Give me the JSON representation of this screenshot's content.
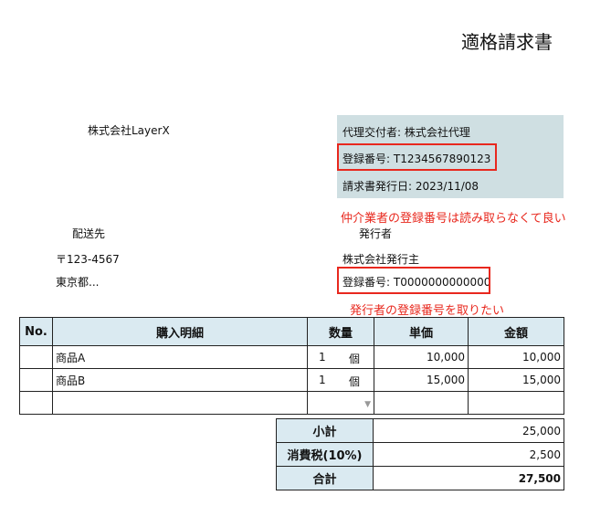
{
  "title": "適格請求書",
  "bill_to": "株式会社LayerX",
  "agent": {
    "issuer": "代理交付者: 株式会社代理",
    "registration": "登録番号: T1234567890123",
    "issue_date": "請求書発行日: 2023/11/08"
  },
  "note_agent": "仲介業者の登録番号は読み取らなくて良い",
  "destination": {
    "label": "配送先",
    "postal": "〒123-4567",
    "address": "東京都..."
  },
  "issuer": {
    "label": "発行者",
    "name": "株式会社発行主",
    "registration": "登録番号: T0000000000000"
  },
  "note_issuer": "発行者の登録番号を取りたい",
  "table": {
    "headers": {
      "no": "No.",
      "desc": "購入明細",
      "qty": "数量",
      "unit": "単価",
      "amount": "金額"
    },
    "rows": [
      {
        "no": "",
        "desc": "商品A",
        "qty": "1",
        "unit_label": "個",
        "unit_price": "10,000",
        "amount": "10,000"
      },
      {
        "no": "",
        "desc": "商品B",
        "qty": "1",
        "unit_label": "個",
        "unit_price": "15,000",
        "amount": "15,000"
      }
    ],
    "dropdown_icon": "triangle-down"
  },
  "totals": {
    "subtotal_label": "小計",
    "subtotal": "25,000",
    "tax_label": "消費税(10%)",
    "tax": "2,500",
    "total_label": "合計",
    "total": "27,500"
  },
  "colors": {
    "agent_bg": "#cfdfe2",
    "header_bg": "#daeaf1",
    "highlight_red": "#e8281e"
  }
}
